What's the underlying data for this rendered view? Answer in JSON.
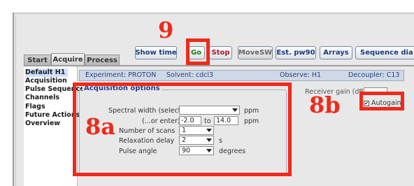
{
  "tabs": [
    {
      "label": "Start",
      "active": false
    },
    {
      "label": "Acquire",
      "active": true
    },
    {
      "label": "Process",
      "active": false
    }
  ],
  "toolbar": {
    "show_time": "Show time",
    "go": "Go",
    "stop": "Stop",
    "movesw": "MoveSW",
    "est_pw90": "Est. pw90",
    "arrays": "Arrays",
    "sequence_diagram": "Sequence dia"
  },
  "sidebar": {
    "items": [
      "Default H1",
      "Acquisition",
      "Pulse Sequence",
      "Channels",
      "Flags",
      "Future Actions",
      "Overview"
    ],
    "selected": 0
  },
  "info_bar": {
    "experiment": "Experiment: PROTON",
    "solvent": "Solvent: cdcl3",
    "observe": "Observe: H1",
    "decoupler": "Decoupler: C13"
  },
  "acquisition": {
    "title": "Acquisition options",
    "spectral_width_label": "Spectral width (select)",
    "spectral_width_value": "",
    "spectral_width_unit": "ppm",
    "enter_label": "(...or enter)",
    "enter_from": "-2.0",
    "enter_to_label": "to",
    "enter_to": "14.0",
    "enter_unit": "ppm",
    "scans_label": "Number of scans",
    "scans_value": "1",
    "relax_label": "Relaxation delay",
    "relax_value": "2",
    "relax_unit": "s",
    "pulse_label": "Pulse angle",
    "pulse_value": "90",
    "pulse_unit": "degrees"
  },
  "receiver": {
    "gain_label": "Receiver gain (dB)",
    "gain_value": "",
    "autogain_label": "Autogain",
    "autogain_checked": true,
    "check_mark": "✔"
  },
  "annotations": {
    "label_9": "9",
    "label_8a": "8a",
    "label_8b": "8b",
    "color": "#ef2a1a"
  }
}
